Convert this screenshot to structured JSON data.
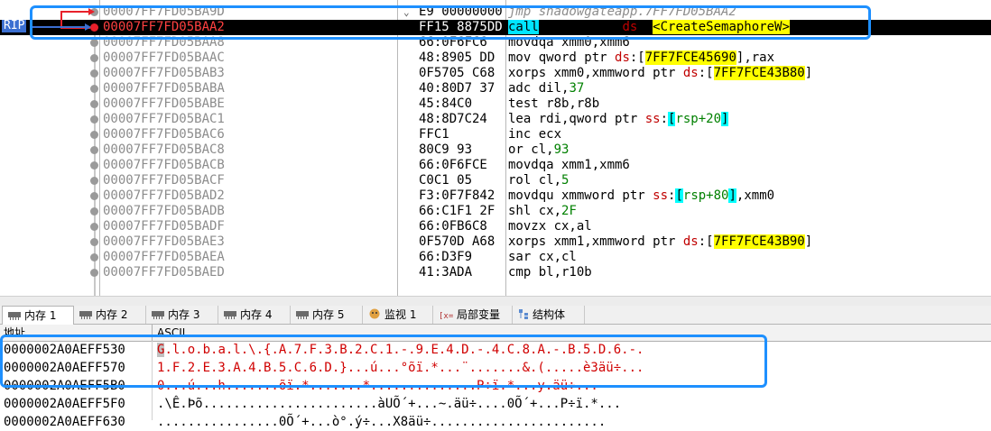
{
  "disasm": {
    "rip_label": "RIP",
    "rows": [
      {
        "addr": "00007FF7FD05BA9D",
        "bytes": "E9 00000000",
        "fold": true,
        "instr": [
          {
            "t": "jmp shadowgateapp.7FF7FD05BAA2",
            "c": "mnem-jmp"
          }
        ]
      },
      {
        "addr": "00007FF7FD05BAA2",
        "bytes": "FF15 8875DD",
        "rip": true,
        "instr": [
          {
            "t": "call",
            "c": "call-hl"
          },
          {
            "t": " qword ptr ",
            "c": ""
          },
          {
            "t": "ds",
            "c": "seg"
          },
          {
            "t": ":[",
            "c": ""
          },
          {
            "t": "<CreateSemaphoreW>",
            "c": "hl-yellow"
          },
          {
            "t": "]",
            "c": ""
          }
        ]
      },
      {
        "addr": "00007FF7FD05BAA8",
        "bytes": "66:0F6FC6",
        "instr": [
          {
            "t": "movdqa xmm0,xmm6",
            "c": ""
          }
        ]
      },
      {
        "addr": "00007FF7FD05BAAC",
        "bytes": "48:8905 DD",
        "instr": [
          {
            "t": "mov qword ptr ",
            "c": ""
          },
          {
            "t": "ds",
            "c": "seg"
          },
          {
            "t": ":[",
            "c": ""
          },
          {
            "t": "7FF7FCE45690",
            "c": "hl-yellow"
          },
          {
            "t": "],rax",
            "c": ""
          }
        ]
      },
      {
        "addr": "00007FF7FD05BAB3",
        "bytes": "0F5705 C68",
        "instr": [
          {
            "t": "xorps xmm0,xmmword ptr ",
            "c": ""
          },
          {
            "t": "ds",
            "c": "seg"
          },
          {
            "t": ":[",
            "c": ""
          },
          {
            "t": "7FF7FCE43B80",
            "c": "hl-yellow"
          },
          {
            "t": "]",
            "c": ""
          }
        ]
      },
      {
        "addr": "00007FF7FD05BABA",
        "bytes": "40:80D7 37",
        "instr": [
          {
            "t": "adc dil,",
            "c": ""
          },
          {
            "t": "37",
            "c": "imm"
          }
        ]
      },
      {
        "addr": "00007FF7FD05BABE",
        "bytes": "45:84C0",
        "instr": [
          {
            "t": "test r8b,r8b",
            "c": ""
          }
        ]
      },
      {
        "addr": "00007FF7FD05BAC1",
        "bytes": "48:8D7C24",
        "instr": [
          {
            "t": "lea rdi,qword ptr ",
            "c": ""
          },
          {
            "t": "ss",
            "c": "seg"
          },
          {
            "t": ":",
            "c": ""
          },
          {
            "t": "[",
            "c": "brk"
          },
          {
            "t": "rsp+20",
            "c": "imm"
          },
          {
            "t": "]",
            "c": "brk"
          }
        ]
      },
      {
        "addr": "00007FF7FD05BAC6",
        "bytes": "FFC1",
        "instr": [
          {
            "t": "inc ecx",
            "c": ""
          }
        ]
      },
      {
        "addr": "00007FF7FD05BAC8",
        "bytes": "80C9 93",
        "instr": [
          {
            "t": "or cl,",
            "c": ""
          },
          {
            "t": "93",
            "c": "imm"
          }
        ]
      },
      {
        "addr": "00007FF7FD05BACB",
        "bytes": "66:0F6FCE",
        "instr": [
          {
            "t": "movdqa xmm1,xmm6",
            "c": ""
          }
        ]
      },
      {
        "addr": "00007FF7FD05BACF",
        "bytes": "C0C1 05",
        "instr": [
          {
            "t": "rol cl,",
            "c": ""
          },
          {
            "t": "5",
            "c": "imm"
          }
        ]
      },
      {
        "addr": "00007FF7FD05BAD2",
        "bytes": "F3:0F7F842",
        "instr": [
          {
            "t": "movdqu xmmword ptr ",
            "c": ""
          },
          {
            "t": "ss",
            "c": "seg"
          },
          {
            "t": ":",
            "c": ""
          },
          {
            "t": "[",
            "c": "brk"
          },
          {
            "t": "rsp+80",
            "c": "imm"
          },
          {
            "t": "]",
            "c": "brk"
          },
          {
            "t": ",xmm0",
            "c": ""
          }
        ]
      },
      {
        "addr": "00007FF7FD05BADB",
        "bytes": "66:C1F1 2F",
        "instr": [
          {
            "t": "shl cx,",
            "c": ""
          },
          {
            "t": "2F",
            "c": "imm"
          }
        ]
      },
      {
        "addr": "00007FF7FD05BADF",
        "bytes": "66:0FB6C8",
        "instr": [
          {
            "t": "movzx cx,al",
            "c": ""
          }
        ]
      },
      {
        "addr": "00007FF7FD05BAE3",
        "bytes": "0F570D A68",
        "instr": [
          {
            "t": "xorps xmm1,xmmword ptr ",
            "c": ""
          },
          {
            "t": "ds",
            "c": "seg"
          },
          {
            "t": ":[",
            "c": ""
          },
          {
            "t": "7FF7FCE43B90",
            "c": "hl-yellow"
          },
          {
            "t": "]",
            "c": ""
          }
        ]
      },
      {
        "addr": "00007FF7FD05BAEA",
        "bytes": "66:D3F9",
        "instr": [
          {
            "t": "sar cx,cl",
            "c": ""
          }
        ]
      },
      {
        "addr": "00007FF7FD05BAED",
        "bytes": "41:3ADA",
        "instr": [
          {
            "t": "cmp bl,r10b",
            "c": ""
          }
        ]
      }
    ]
  },
  "tabs": [
    {
      "label": "内存 1",
      "icon": "memory-icon",
      "active": true
    },
    {
      "label": "内存 2",
      "icon": "memory-icon"
    },
    {
      "label": "内存 3",
      "icon": "memory-icon"
    },
    {
      "label": "内存 4",
      "icon": "memory-icon"
    },
    {
      "label": "内存 5",
      "icon": "memory-icon"
    },
    {
      "label": "监视 1",
      "icon": "watch-icon"
    },
    {
      "label": "局部变量",
      "icon": "locals-icon"
    },
    {
      "label": "结构体",
      "icon": "struct-icon"
    }
  ],
  "dump": {
    "header_addr": "地址",
    "header_ascii": "ASCII",
    "rows": [
      {
        "addr": "0000002A0AEFF530",
        "ascii": "G.l.o.b.a.l.\\.{.A.7.F.3.B.2.C.1.-.9.E.4.D.-.4.C.8.A.-.B.5.D.6.-.",
        "mod": true
      },
      {
        "addr": "0000002A0AEFF570",
        "ascii": "1.F.2.E.3.A.4.B.5.C.6.D.}...ú...°õï.*...¨.......&.(.....è3äü÷...",
        "mod": true
      },
      {
        "addr": "0000002A0AEFF5B0",
        "ascii": "0...ú...h.......õï.*.......*..............P÷ï.*...y.äü÷...",
        "mod": true
      },
      {
        "addr": "0000002A0AEFF5F0",
        "ascii": ".\\Ê.Þõ.......................àUÕ´+...~.äü÷....0Õ´+...P÷ï.*...",
        "mod": false
      },
      {
        "addr": "0000002A0AEFF630",
        "ascii": "................0Õ´+...ò°.ý÷...X8äü÷.......................",
        "mod": false
      }
    ]
  },
  "colors": {
    "annotation": "#1e90ff",
    "rip_row": "#000000",
    "highlight": "#ffff00",
    "call_highlight": "#00e5ff"
  }
}
